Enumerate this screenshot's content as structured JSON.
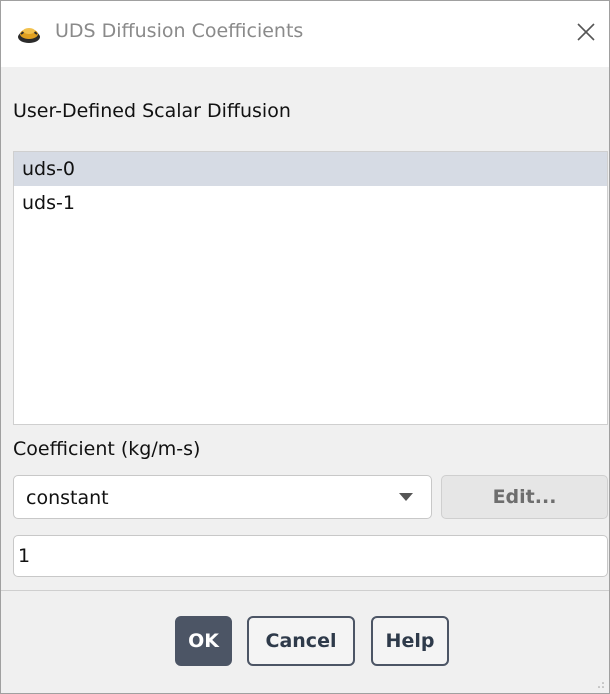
{
  "window": {
    "title": "UDS Diffusion Coefficients",
    "icon": "ansys-fluent-icon",
    "close_icon": "close-icon"
  },
  "scalar_section": {
    "label": "User-Defined Scalar Diffusion",
    "items": [
      {
        "label": "uds-0",
        "selected": true
      },
      {
        "label": "uds-1",
        "selected": false
      }
    ]
  },
  "coefficient": {
    "label": "Coefficient (kg/m-s)",
    "method_value": "constant",
    "edit_label": "Edit...",
    "value": "1"
  },
  "buttons": {
    "ok": "OK",
    "cancel": "Cancel",
    "help": "Help"
  },
  "colors": {
    "accent": "#4c5565",
    "selection": "#d6dbe4"
  }
}
